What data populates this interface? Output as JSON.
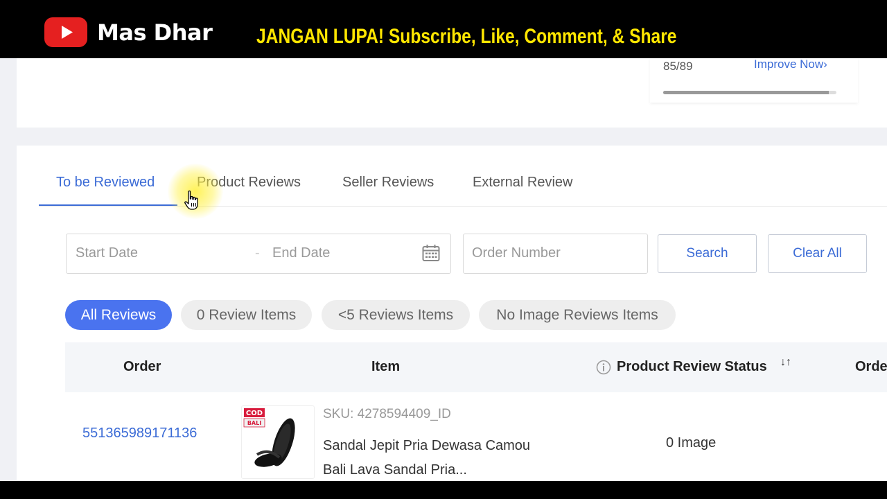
{
  "banner": {
    "channel_name": "Mas Dhar",
    "promo_text": "JANGAN LUPA! Subscribe, Like, Comment, & Share"
  },
  "score": {
    "value": "85/89",
    "improve_label": "Improve Now",
    "progress_fraction": 0.955
  },
  "tabs": [
    {
      "label": "To be Reviewed",
      "active": true
    },
    {
      "label": "Product Reviews",
      "active": false
    },
    {
      "label": "Seller Reviews",
      "active": false
    },
    {
      "label": "External Review",
      "active": false
    }
  ],
  "filters": {
    "start_date_placeholder": "Start Date",
    "separator": "-",
    "end_date_placeholder": "End Date",
    "order_number_placeholder": "Order Number",
    "search_label": "Search",
    "clear_label": "Clear All"
  },
  "chips": [
    {
      "label": "All Reviews",
      "active": true
    },
    {
      "label": "0 Review Items",
      "active": false
    },
    {
      "label": "<5 Reviews Items",
      "active": false
    },
    {
      "label": "No Image Reviews Items",
      "active": false
    }
  ],
  "table": {
    "columns": [
      "Order",
      "Item",
      "Product Review Status",
      "Orde"
    ],
    "rows": [
      {
        "order_number": "551365989171136",
        "thumb_badges": [
          "COD",
          "BALI"
        ],
        "sku": "SKU: 4278594409_ID",
        "product_name": "Sandal Jepit Pria Dewasa Camou Bali Lava Sandal Pria...",
        "review_status": "0 Image"
      }
    ]
  },
  "colors": {
    "accent": "#3b6bd6",
    "chip_active": "#4a73ef",
    "youtube_red": "#e52020",
    "promo_yellow": "#ffe600"
  }
}
